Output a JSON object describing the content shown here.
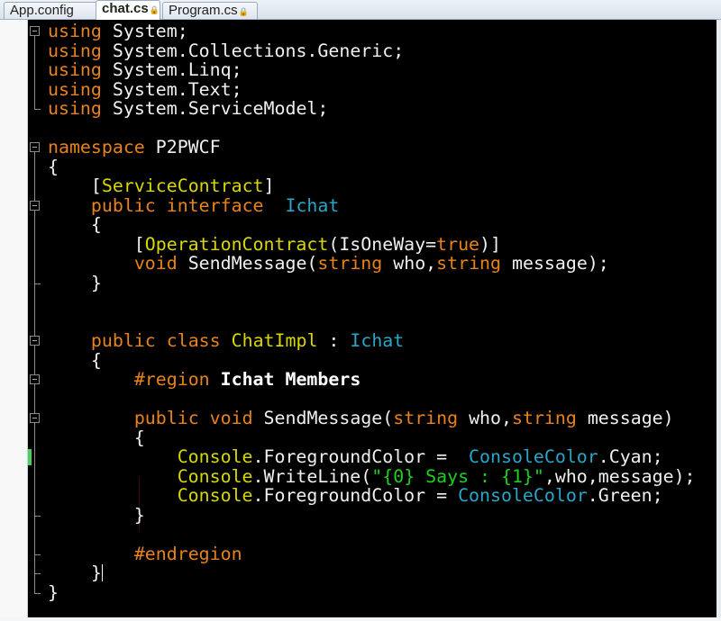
{
  "tabs": [
    {
      "label": "App.config",
      "locked": false,
      "active": false
    },
    {
      "label": "chat.cs",
      "locked": true,
      "active": true
    },
    {
      "label": "Program.cs",
      "locked": true,
      "active": false
    }
  ],
  "lock_icon": "🔒",
  "code": [
    [
      [
        "using",
        "kw"
      ],
      [
        " System;",
        ""
      ]
    ],
    [
      [
        "using",
        "kw"
      ],
      [
        " System.Collections.Generic;",
        ""
      ]
    ],
    [
      [
        "using",
        "kw"
      ],
      [
        " System.Linq;",
        ""
      ]
    ],
    [
      [
        "using",
        "kw"
      ],
      [
        " System.Text;",
        ""
      ]
    ],
    [
      [
        "using",
        "kw"
      ],
      [
        " System.ServiceModel;",
        ""
      ]
    ],
    [],
    [
      [
        "namespace",
        "kw"
      ],
      [
        " P2PWCF",
        ""
      ]
    ],
    [
      [
        "{",
        ""
      ]
    ],
    [
      [
        "    [",
        ""
      ],
      [
        "ServiceContract",
        "ty"
      ],
      [
        "]",
        ""
      ]
    ],
    [
      [
        "    ",
        ""
      ],
      [
        "public",
        "kw"
      ],
      [
        " ",
        ""
      ],
      [
        "interface",
        "kw"
      ],
      [
        "  ",
        ""
      ],
      [
        "Ichat",
        "cy"
      ]
    ],
    [
      [
        "    {",
        ""
      ]
    ],
    [
      [
        "        [",
        ""
      ],
      [
        "OperationContract",
        "ty"
      ],
      [
        "(IsOneWay=",
        ""
      ],
      [
        "true",
        "kw"
      ],
      [
        ")]",
        ""
      ]
    ],
    [
      [
        "        ",
        ""
      ],
      [
        "void",
        "kw"
      ],
      [
        " SendMessage(",
        ""
      ],
      [
        "string",
        "kw"
      ],
      [
        " who,",
        ""
      ],
      [
        "string",
        "kw"
      ],
      [
        " message);",
        ""
      ]
    ],
    [
      [
        "    }",
        ""
      ]
    ],
    [],
    [],
    [
      [
        "    ",
        ""
      ],
      [
        "public",
        "kw"
      ],
      [
        " ",
        ""
      ],
      [
        "class",
        "kw"
      ],
      [
        " ",
        ""
      ],
      [
        "ChatImpl",
        "ty"
      ],
      [
        " : ",
        ""
      ],
      [
        "Ichat",
        "cy"
      ]
    ],
    [
      [
        "    {",
        ""
      ]
    ],
    [
      [
        "        ",
        ""
      ],
      [
        "#region",
        "kw"
      ],
      [
        " ",
        ""
      ],
      [
        "Ichat Members",
        "bd"
      ]
    ],
    [],
    [
      [
        "        ",
        ""
      ],
      [
        "public",
        "kw"
      ],
      [
        " ",
        ""
      ],
      [
        "void",
        "kw"
      ],
      [
        " SendMessage(",
        ""
      ],
      [
        "string",
        "kw"
      ],
      [
        " who,",
        ""
      ],
      [
        "string",
        "kw"
      ],
      [
        " message)",
        ""
      ]
    ],
    [
      [
        "        {",
        ""
      ]
    ],
    [
      [
        "            ",
        ""
      ],
      [
        "Console",
        "ty"
      ],
      [
        ".ForegroundColor =  ",
        ""
      ],
      [
        "ConsoleColor",
        "cy"
      ],
      [
        ".Cyan;",
        ""
      ]
    ],
    [
      [
        "            ",
        ""
      ],
      [
        "Console",
        "ty"
      ],
      [
        ".WriteLine(",
        ""
      ],
      [
        "\"{0} Says : {1}\"",
        "st"
      ],
      [
        ",who,message);",
        ""
      ]
    ],
    [
      [
        "            ",
        ""
      ],
      [
        "Console",
        "ty"
      ],
      [
        ".ForegroundColor = ",
        ""
      ],
      [
        "ConsoleColor",
        "cy"
      ],
      [
        ".Green;",
        ""
      ]
    ],
    [
      [
        "        }",
        ""
      ]
    ],
    [],
    [
      [
        "        ",
        ""
      ],
      [
        "#endregion",
        "kw"
      ]
    ],
    [
      [
        "    }",
        ""
      ]
    ],
    [
      [
        "}",
        ""
      ]
    ]
  ],
  "caret_line": 28
}
